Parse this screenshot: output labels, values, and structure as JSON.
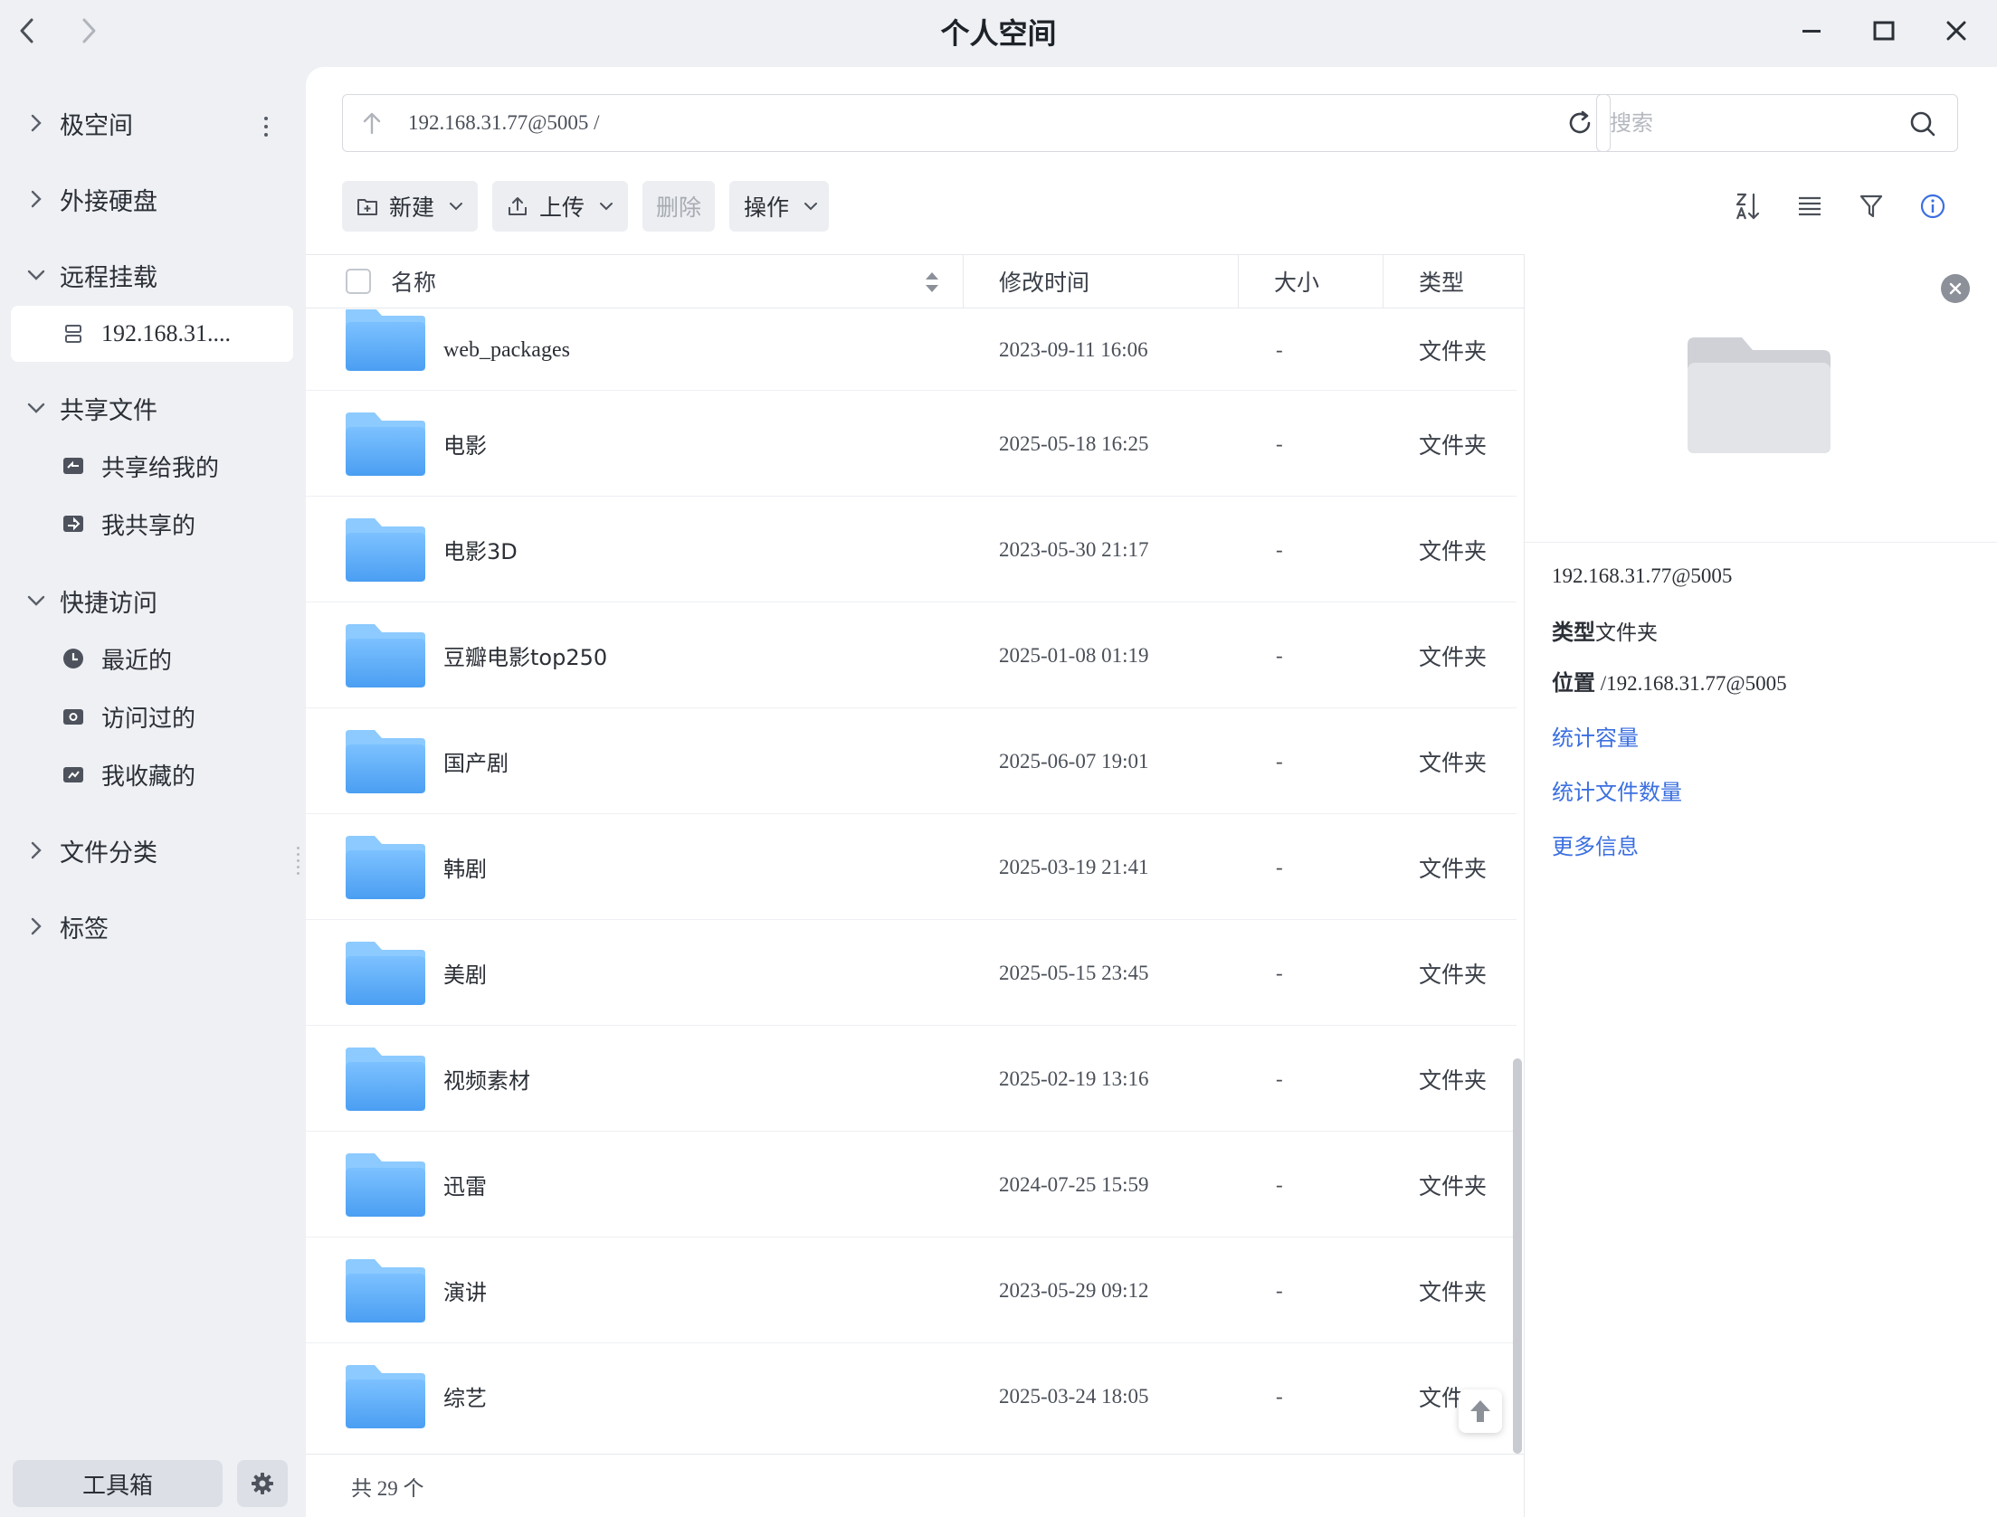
{
  "window": {
    "title": "个人空间",
    "back_icon": "chevron-left-icon",
    "forward_icon": "chevron-right-icon",
    "minimize_icon": "minimize-icon",
    "maximize_icon": "maximize-icon",
    "close_icon": "close-icon"
  },
  "sidebar": {
    "sections": [
      {
        "label": "极空间",
        "expanded": false
      },
      {
        "label": "外接硬盘",
        "expanded": false
      },
      {
        "label": "远程挂载",
        "expanded": true
      },
      {
        "label": "共享文件",
        "expanded": true
      },
      {
        "label": "快捷访问",
        "expanded": true
      },
      {
        "label": "文件分类",
        "expanded": false
      },
      {
        "label": "标签",
        "expanded": false
      }
    ],
    "items": [
      {
        "label": "192.168.31....",
        "icon": "server-icon",
        "active": true
      },
      {
        "label": "共享给我的",
        "icon": "shared-with-me-icon"
      },
      {
        "label": "我共享的",
        "icon": "my-shares-icon"
      },
      {
        "label": "最近的",
        "icon": "clock-icon"
      },
      {
        "label": "访问过的",
        "icon": "eye-icon"
      },
      {
        "label": "我收藏的",
        "icon": "star-icon"
      }
    ],
    "toolbox_label": "工具箱",
    "settings_icon": "gear-icon"
  },
  "address": {
    "path": "192.168.31.77@5005 /",
    "up_icon": "arrow-up-icon",
    "refresh_icon": "refresh-icon"
  },
  "search": {
    "placeholder": "搜索",
    "value": "",
    "icon": "search-icon"
  },
  "toolbar": {
    "new_label": "新建",
    "upload_label": "上传",
    "delete_label": "删除",
    "actions_label": "操作",
    "sort_icon": "sort-az-icon",
    "list_icon": "list-view-icon",
    "filter_icon": "filter-icon",
    "info_icon": "info-icon"
  },
  "table": {
    "columns": {
      "name": "名称",
      "mtime": "修改时间",
      "size": "大小",
      "type": "类型"
    },
    "rows": [
      {
        "name": "web_packages",
        "mtime": "2023-09-11 16:06",
        "size": "-",
        "type": "文件夹"
      },
      {
        "name": "电影",
        "mtime": "2025-05-18 16:25",
        "size": "-",
        "type": "文件夹"
      },
      {
        "name": "电影3D",
        "mtime": "2023-05-30 21:17",
        "size": "-",
        "type": "文件夹"
      },
      {
        "name": "豆瓣电影top250",
        "mtime": "2025-01-08 01:19",
        "size": "-",
        "type": "文件夹"
      },
      {
        "name": "国产剧",
        "mtime": "2025-06-07 19:01",
        "size": "-",
        "type": "文件夹"
      },
      {
        "name": "韩剧",
        "mtime": "2025-03-19 21:41",
        "size": "-",
        "type": "文件夹"
      },
      {
        "name": "美剧",
        "mtime": "2025-05-15 23:45",
        "size": "-",
        "type": "文件夹"
      },
      {
        "name": "视频素材",
        "mtime": "2025-02-19 13:16",
        "size": "-",
        "type": "文件夹"
      },
      {
        "name": "迅雷",
        "mtime": "2024-07-25 15:59",
        "size": "-",
        "type": "文件夹"
      },
      {
        "name": "演讲",
        "mtime": "2023-05-29 09:12",
        "size": "-",
        "type": "文件夹"
      },
      {
        "name": "综艺",
        "mtime": "2025-03-24 18:05",
        "size": "-",
        "type": "文件"
      }
    ],
    "footer": "共 29 个"
  },
  "info_panel": {
    "title": "192.168.31.77@5005",
    "type_label": "类型",
    "type_value": "文件夹",
    "location_label": "位置",
    "location_value": " /192.168.31.77@5005",
    "links": [
      "统计容量",
      "统计文件数量",
      "更多信息"
    ]
  },
  "colors": {
    "accent": "#3b6fe0",
    "folder_blue": "#5aa9f5",
    "sidebar_bg": "#eef0f4"
  }
}
